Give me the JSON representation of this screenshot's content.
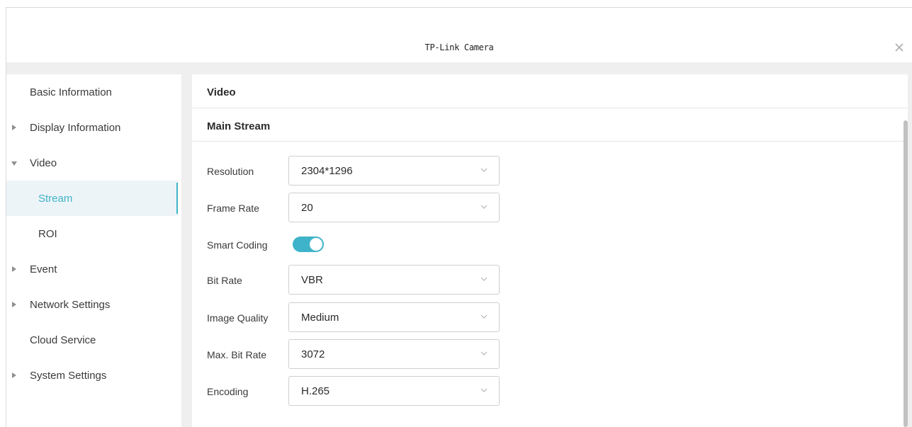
{
  "window": {
    "title": "TP-Link Camera"
  },
  "sidebar": {
    "items": [
      {
        "label": "Basic Information",
        "arrow": "none"
      },
      {
        "label": "Display Information",
        "arrow": "right"
      },
      {
        "label": "Video",
        "arrow": "down"
      },
      {
        "label": "Stream",
        "arrow": "none",
        "active": true,
        "sub": true
      },
      {
        "label": "ROI",
        "arrow": "none",
        "sub": true
      },
      {
        "label": "Event",
        "arrow": "right"
      },
      {
        "label": "Network Settings",
        "arrow": "right"
      },
      {
        "label": "Cloud Service",
        "arrow": "none"
      },
      {
        "label": "System Settings",
        "arrow": "right"
      }
    ]
  },
  "main": {
    "section_title": "Video",
    "subsection_title": "Main Stream",
    "fields": {
      "resolution": {
        "label": "Resolution",
        "value": "2304*1296"
      },
      "frame_rate": {
        "label": "Frame Rate",
        "value": "20"
      },
      "smart_coding": {
        "label": "Smart Coding",
        "enabled": true
      },
      "bit_rate": {
        "label": "Bit Rate",
        "value": "VBR"
      },
      "image_quality": {
        "label": "Image Quality",
        "value": "Medium"
      },
      "max_bit_rate": {
        "label": "Max. Bit Rate",
        "value": "3072"
      },
      "encoding": {
        "label": "Encoding",
        "value": "H.265"
      }
    }
  },
  "colors": {
    "accent": "#3fb3c9",
    "active_bg": "#edf4f7",
    "window_bg": "#efefef"
  },
  "icons": {
    "close": "close-icon",
    "dropdown": "chevron-down-icon",
    "expand": "triangle-right-icon",
    "collapse": "triangle-down-icon"
  }
}
